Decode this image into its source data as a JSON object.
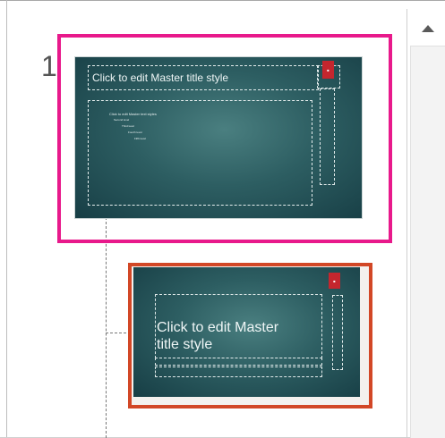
{
  "thumbnail_pane": {
    "slide_number": "1",
    "master": {
      "title": "Click to edit Master title style",
      "body_levels": [
        "Click to edit Master text styles",
        "Second level",
        "Third level",
        "Fourth level",
        "Fifth level"
      ]
    },
    "layout": {
      "title_line1": "Click to edit Master",
      "title_line2": "title style"
    },
    "colors": {
      "master_selection_border": "#e8198b",
      "layout_selection_border": "#d24726",
      "slide_background": "#2d5e62",
      "logo": "#c4262e"
    }
  },
  "scrollbar": {
    "up_arrow_icon": "triangle-up"
  }
}
